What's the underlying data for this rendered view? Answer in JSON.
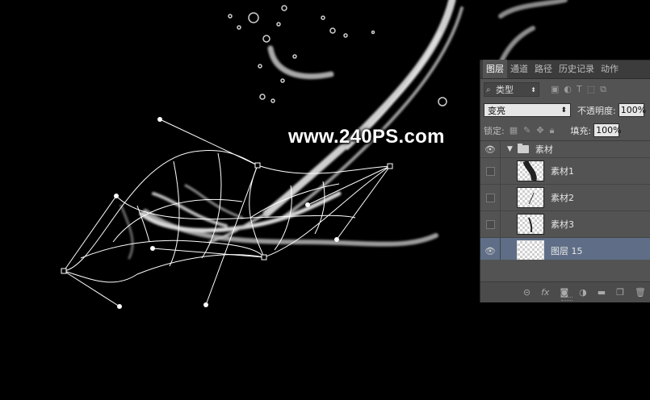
{
  "watermark": "www.240PS.com",
  "panel": {
    "tabs": [
      "图层",
      "通道",
      "路径",
      "历史记录",
      "动作"
    ],
    "filter": {
      "label": "类型",
      "icons": [
        "image-filter-icon",
        "adjustment-filter-icon",
        "type-filter-icon",
        "shape-filter-icon",
        "smart-object-filter-icon"
      ]
    },
    "blend_mode": "变亮",
    "opacity_label": "不透明度:",
    "opacity_value": "100%",
    "lock_label": "锁定:",
    "fill_label": "填充:",
    "fill_value": "100%",
    "group_name": "素材",
    "layers": [
      {
        "name": "素材1",
        "visible": false
      },
      {
        "name": "素材2",
        "visible": false
      },
      {
        "name": "素材3",
        "visible": false
      },
      {
        "name": "图层 15",
        "visible": true,
        "selected": true
      }
    ],
    "bottom_icons": [
      "link-icon",
      "fx-icon",
      "mask-icon",
      "adjustment-icon",
      "new-group-icon",
      "new-layer-icon",
      "trash-icon"
    ]
  },
  "colors": {
    "selected_row": "#5f6e86",
    "panel_bg": "#535353"
  }
}
